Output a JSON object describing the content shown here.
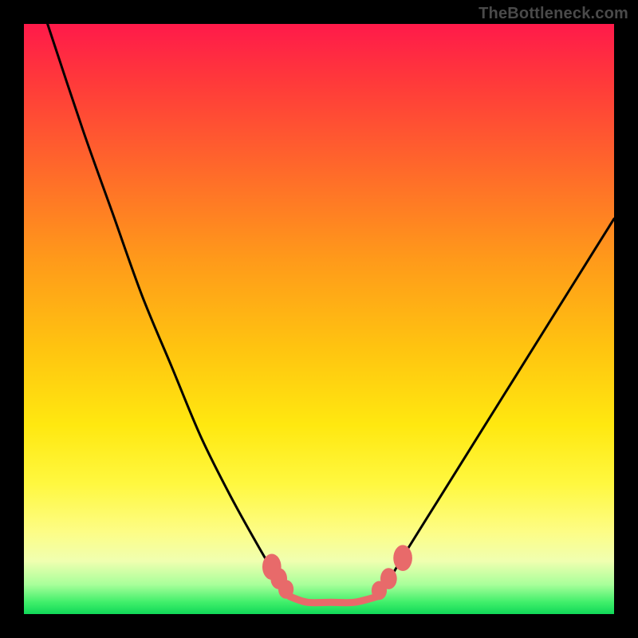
{
  "attribution": "TheBottleneck.com",
  "chart_data": {
    "type": "line",
    "title": "",
    "xlabel": "",
    "ylabel": "",
    "xlim": [
      0,
      100
    ],
    "ylim": [
      0,
      100
    ],
    "grid": false,
    "series": [
      {
        "name": "left-curve",
        "color": "#000000",
        "x": [
          4,
          10,
          15,
          20,
          25,
          30,
          35,
          40,
          43,
          45
        ],
        "y": [
          100,
          82,
          68,
          54,
          42,
          30,
          20,
          11,
          6,
          3
        ]
      },
      {
        "name": "right-curve",
        "color": "#000000",
        "x": [
          60,
          62,
          65,
          70,
          75,
          80,
          85,
          90,
          95,
          100
        ],
        "y": [
          3,
          6,
          11,
          19,
          27,
          35,
          43,
          51,
          59,
          67
        ]
      },
      {
        "name": "valley-floor",
        "color": "#e86a6a",
        "x": [
          45,
          48,
          52,
          56,
          60
        ],
        "y": [
          3,
          2,
          2,
          2,
          3
        ]
      }
    ],
    "markers": [
      {
        "name": "left-marker-1",
        "x": 42.0,
        "y": 8.0,
        "rx": 1.6,
        "ry": 2.2
      },
      {
        "name": "left-marker-2",
        "x": 43.2,
        "y": 6.0,
        "rx": 1.4,
        "ry": 1.8
      },
      {
        "name": "left-marker-3",
        "x": 44.4,
        "y": 4.2,
        "rx": 1.3,
        "ry": 1.6
      },
      {
        "name": "right-marker-1",
        "x": 60.2,
        "y": 4.0,
        "rx": 1.3,
        "ry": 1.6
      },
      {
        "name": "right-marker-2",
        "x": 61.8,
        "y": 6.0,
        "rx": 1.4,
        "ry": 1.8
      },
      {
        "name": "right-marker-3",
        "x": 64.2,
        "y": 9.5,
        "rx": 1.6,
        "ry": 2.2
      }
    ],
    "marker_color": "#e86a6a",
    "valley_link_color": "#e86a6a"
  }
}
